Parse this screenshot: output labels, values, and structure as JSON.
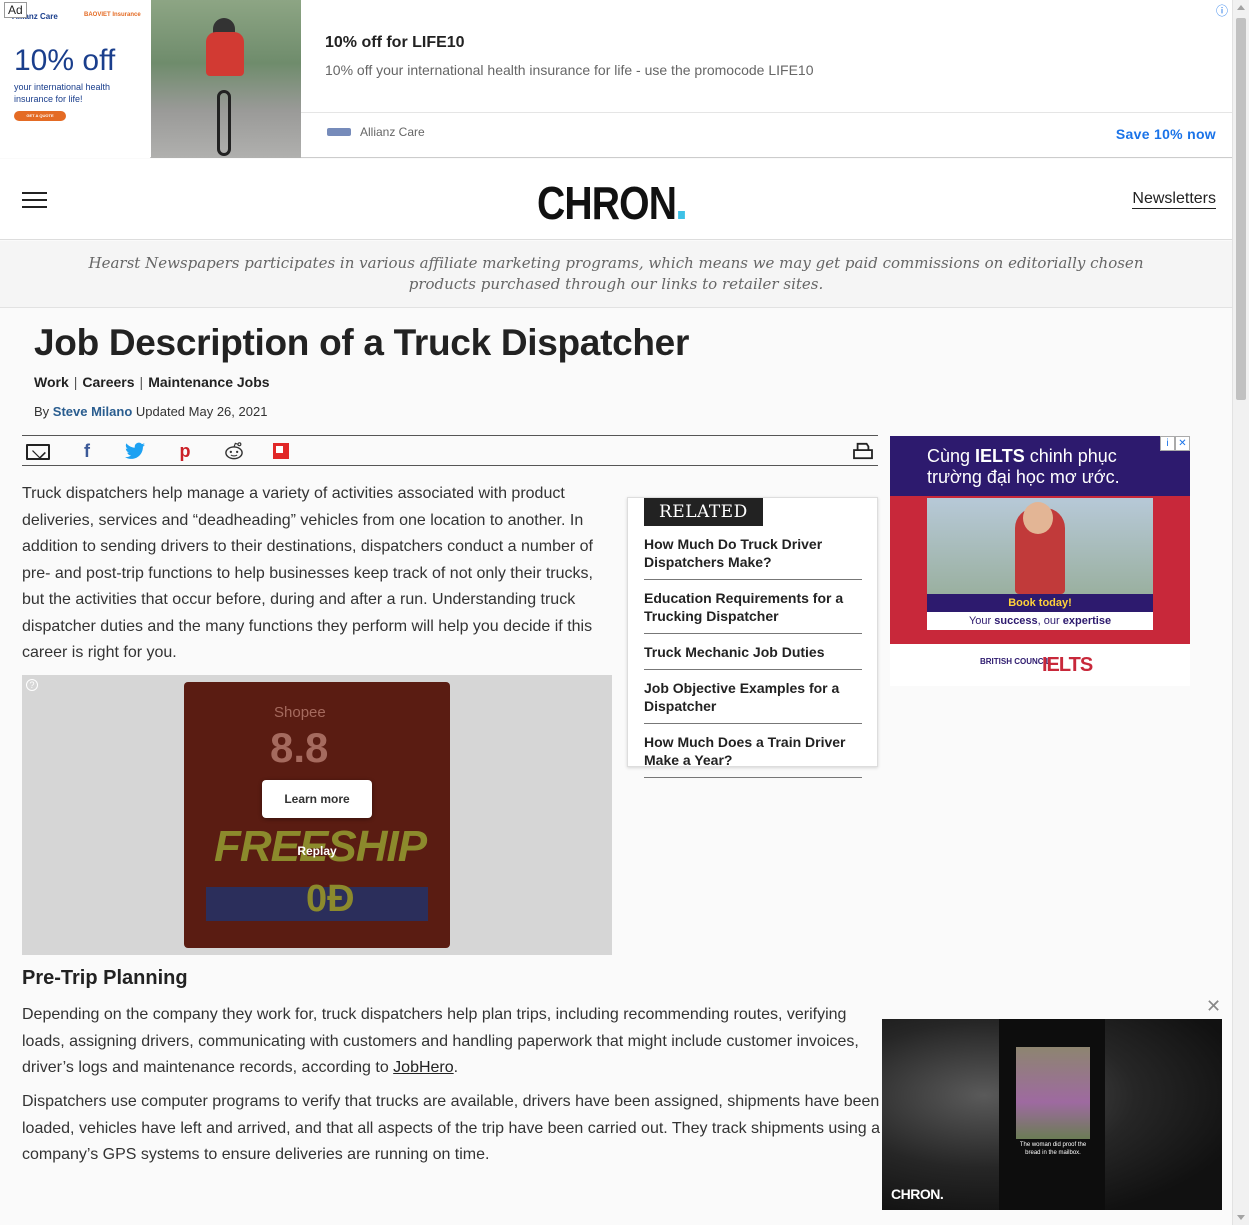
{
  "ad_top": {
    "tag": "Ad",
    "brand_left": "Allianz Care",
    "brand_right": "BAOVIET Insurance",
    "offer": "10% off",
    "sub": "your international health insurance for life!",
    "cta": "GET A QUOTE",
    "title": "10% off for LIFE10",
    "description": "10% off your international health insurance for life - use the promocode LIFE10",
    "advertiser": "Allianz Care",
    "action": "Save 10% now",
    "info_icon": "ⓘ"
  },
  "header": {
    "logo": "CHRON",
    "newsletters": "Newsletters"
  },
  "disclaimer": "Hearst Newspapers participates in various affiliate marketing programs, which means we may get paid commissions on editorially chosen products purchased through our links to retailer sites.",
  "article": {
    "title": "Job Description of a Truck Dispatcher",
    "categories": [
      "Work",
      "Careers",
      "Maintenance Jobs"
    ],
    "by": "By",
    "author": "Steve Milano",
    "updated": "Updated May 26, 2021",
    "intro": "Truck dispatchers help manage a variety of activities associated with product deliveries, services and “deadheading” vehicles from one location to another. In addition to sending drivers to their destinations, dispatchers conduct a number of pre- and post-trip functions to help businesses keep track of not only their trucks, but the activities that occur before, during and after a run. Understanding truck dispatcher duties and the many functions they perform will help you decide if this career is right for you.",
    "section_heading": "Pre-Trip Planning",
    "para2_before": "Depending on the company they work for, truck dispatchers help plan trips, including recommending routes, verifying loads, assigning drivers, communicating with customers and handling paperwork that might include customer invoices, driver’s logs and maintenance records, according to ",
    "para2_link": "JobHero",
    "para2_after": ".",
    "para3": "Dispatchers use computer programs to verify that trucks are available, drivers have been assigned, shipments have been loaded, vehicles have left and arrived, and that all aspects of the trip have been carried out. They track shipments using a company’s GPS systems to ensure deliveries are running on time."
  },
  "share_icons": [
    "email-icon",
    "facebook-icon",
    "twitter-icon",
    "pinterest-icon",
    "reddit-icon",
    "flipboard-icon",
    "print-icon"
  ],
  "video_ad": {
    "brand": "Shopee",
    "big": "8.8",
    "headline": "FREESHIP",
    "odong": "0Đ",
    "learn_more": "Learn more",
    "replay": "Replay"
  },
  "related": {
    "heading": "RELATED",
    "items": [
      "How Much Do Truck Driver Dispatchers Make?",
      "Education Requirements for a Trucking Dispatcher",
      "Truck Mechanic Job Duties",
      "Job Objective Examples for a Dispatcher",
      "How Much Does a Train Driver Make a Year?"
    ]
  },
  "side_ad": {
    "line1_pre": "Cùng ",
    "line1_bold": "IELTS",
    "line1_post": " chinh phục",
    "line2": "trường đại học mơ ước.",
    "book": "Book today!",
    "success_pre": "Your ",
    "success_b1": "success",
    "success_mid": ", our ",
    "success_b2": "expertise",
    "bc": "BRITISH COUNCIL",
    "ielts": "IELTS"
  },
  "sticky_video": {
    "caption": "The woman did proof the bread in the mailbox.",
    "logo": "CHRON."
  },
  "colors": {
    "author_link": "#2a5d8f",
    "ad_action": "#1a73e8",
    "logo_dot": "#3ec1e6"
  }
}
